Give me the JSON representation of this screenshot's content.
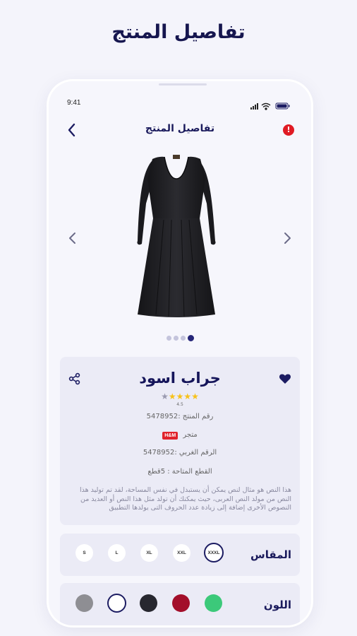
{
  "headline": "تفاصيل المنتج",
  "status_bar": {
    "time": "9:41"
  },
  "nav": {
    "title": "تفاصيل المنتج",
    "alert_symbol": "!"
  },
  "gallery": {
    "dots": [
      false,
      false,
      false,
      true
    ]
  },
  "product": {
    "title": "جراب اسود",
    "rating": 4,
    "rating_text": "4.5",
    "product_number": "رقم المنتج :5478952",
    "store_label": "متجر",
    "store_logo": "H&M",
    "western_number": "الرقم الغربي :5478952",
    "available_pieces": "القطع المتاحة : 5قطع",
    "description": "هذا النص هو مثال لنص يمكن أن يستبدل في نفس المساحة، لقد تم توليد هذا النص من مولد النص العربى، حيث يمكنك أن تولد مثل هذا النص أو العديد من النصوص الأخرى إضافة إلى زيادة عدد الحروف التى يولدها التطبيق"
  },
  "size_section": {
    "label": "المقاس",
    "sizes": [
      "S",
      "L",
      "XL",
      "XXL",
      "XXXL"
    ],
    "selected_index": 4
  },
  "color_section": {
    "label": "اللون",
    "colors": [
      "#8e8e93",
      "#ffffff",
      "#27272f",
      "#a30e2a",
      "#3cc97a"
    ],
    "selected_index": 1
  },
  "accent_color": "#1c1c62",
  "star_color": "#f7c21a"
}
